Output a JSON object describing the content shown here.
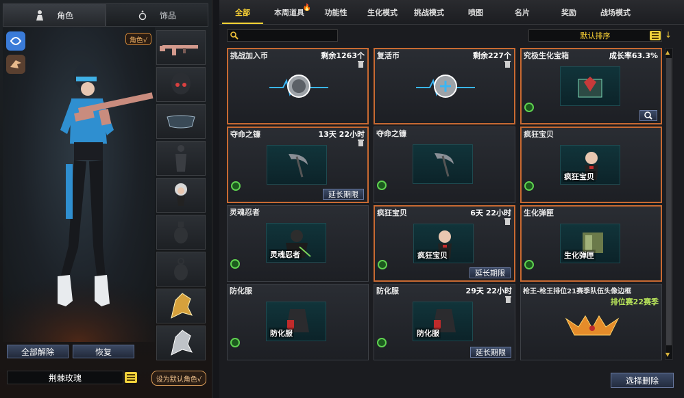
{
  "left_tabs": [
    {
      "label": "角色",
      "active": true,
      "icon": "character-icon"
    },
    {
      "label": "饰品",
      "active": false,
      "icon": "ring-icon"
    }
  ],
  "role_badge": "角色√",
  "equip_slots": [
    "rifle",
    "helmet",
    "goggles",
    "silhouette-body",
    "chibi-pet",
    "empty",
    "grenade",
    "golden-wolf",
    "silver-wolf"
  ],
  "buttons": {
    "unequip_all": "全部解除",
    "restore": "恢复",
    "set_default": "设为默认角色√",
    "multi_delete": "选择删除"
  },
  "character_name": "荆棘玫瑰",
  "tabs": [
    {
      "label": "全部",
      "active": true
    },
    {
      "label": "本周道具",
      "active": false,
      "hot": true
    },
    {
      "label": "功能性",
      "active": false
    },
    {
      "label": "生化模式",
      "active": false
    },
    {
      "label": "挑战模式",
      "active": false
    },
    {
      "label": "喷图",
      "active": false
    },
    {
      "label": "名片",
      "active": false
    },
    {
      "label": "奖励",
      "active": false
    },
    {
      "label": "战场模式",
      "active": false
    }
  ],
  "search": {
    "placeholder": "",
    "value": ""
  },
  "sort_label": "默认排序",
  "items": [
    {
      "name": "挑战加入币",
      "info": "剩余1263个",
      "trash": true,
      "pic": "challenge-coin"
    },
    {
      "name": "复活币",
      "info": "剩余227个",
      "trash": true,
      "pic": "revive-coin"
    },
    {
      "name": "究极生化宝箱",
      "info": "成长率63.3%",
      "pic": "zombie-box",
      "green": true,
      "magnify": true,
      "selected": true
    },
    {
      "name": "夺命之镰",
      "info": "13天 22小时",
      "trash": true,
      "pic": "scythe",
      "green": true,
      "extend": true,
      "selected": true
    },
    {
      "name": "夺命之镰",
      "info": "",
      "pic": "scythe",
      "green": true
    },
    {
      "name": "疯狂宝贝",
      "info": "",
      "pic": "crazy-baby",
      "caption": "疯狂宝贝",
      "green": true,
      "selected": true
    },
    {
      "name": "灵魂忍者",
      "info": "",
      "pic": "soul-ninja",
      "caption": "灵魂忍者",
      "green": true
    },
    {
      "name": "疯狂宝贝",
      "info": "6天 22小时",
      "trash": true,
      "pic": "crazy-baby",
      "caption": "疯狂宝贝",
      "green": true,
      "extend": true,
      "selected": true
    },
    {
      "name": "生化弹匣",
      "info": "",
      "pic": "bio-magazine",
      "caption": "生化弹匣",
      "green": true,
      "selected": true
    },
    {
      "name": "防化服",
      "info": "",
      "pic": "hazmat-suit",
      "caption": "防化服",
      "green": true
    },
    {
      "name": "防化服",
      "info": "29天 22小时",
      "trash": true,
      "pic": "hazmat-suit",
      "caption": "防化服",
      "green": true,
      "extend": true
    },
    {
      "name": "枪王-枪王排位21赛季队伍头像边框",
      "info": "",
      "sub": "排位赛22赛季",
      "pic": "gold-frame"
    }
  ],
  "extend_label": "延长期限",
  "colors": {
    "accent": "#ffd535",
    "select_border": "#c96a32",
    "button": "#2f3b55",
    "green": "#5fd250"
  }
}
